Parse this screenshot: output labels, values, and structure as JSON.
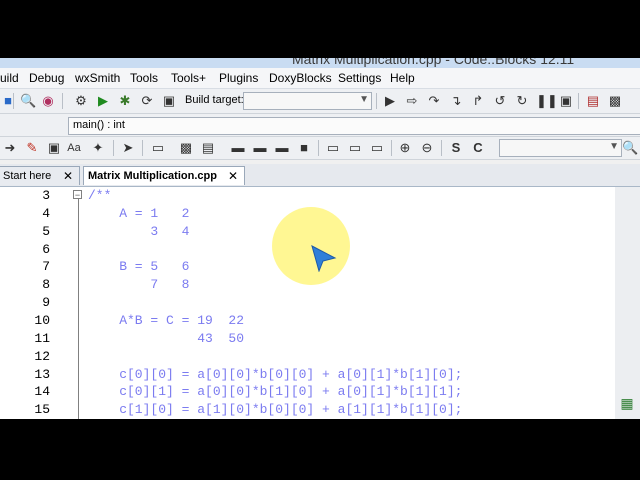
{
  "window": {
    "title": "Matrix Multiplication.cpp - Code::Blocks 12.11"
  },
  "menu": [
    "uild",
    "Debug",
    "wxSmith",
    "Tools",
    "Tools+",
    "Plugins",
    "DoxyBlocks",
    "Settings",
    "Help"
  ],
  "toolbar": {
    "build_target_label": "Build target:",
    "build_target_value": "",
    "scope_value": "main() : int",
    "search_value": ""
  },
  "tabs": [
    {
      "label": "Start here",
      "active": false
    },
    {
      "label": "Matrix Multiplication.cpp",
      "active": true
    }
  ],
  "editor": {
    "lines": [
      {
        "num": "3",
        "text": "/**"
      },
      {
        "num": "4",
        "text": "    A = 1   2"
      },
      {
        "num": "5",
        "text": "        3   4"
      },
      {
        "num": "6",
        "text": ""
      },
      {
        "num": "7",
        "text": "    B = 5   6"
      },
      {
        "num": "8",
        "text": "        7   8"
      },
      {
        "num": "9",
        "text": ""
      },
      {
        "num": "10",
        "text": "    A*B = C = 19  22"
      },
      {
        "num": "11",
        "text": "              43  50"
      },
      {
        "num": "12",
        "text": ""
      },
      {
        "num": "13",
        "text": "    c[0][0] = a[0][0]*b[0][0] + a[0][1]*b[1][0];"
      },
      {
        "num": "14",
        "text": "    c[0][1] = a[0][0]*b[1][0] + a[0][1]*b[1][1];"
      },
      {
        "num": "15",
        "text": "    c[1][0] = a[1][0]*b[0][0] + a[1][1]*b[1][0];"
      }
    ]
  },
  "colors": {
    "comment": "#7b7bf0",
    "cursor_highlight": "#fff680",
    "cursor": "#2f7fd8"
  }
}
